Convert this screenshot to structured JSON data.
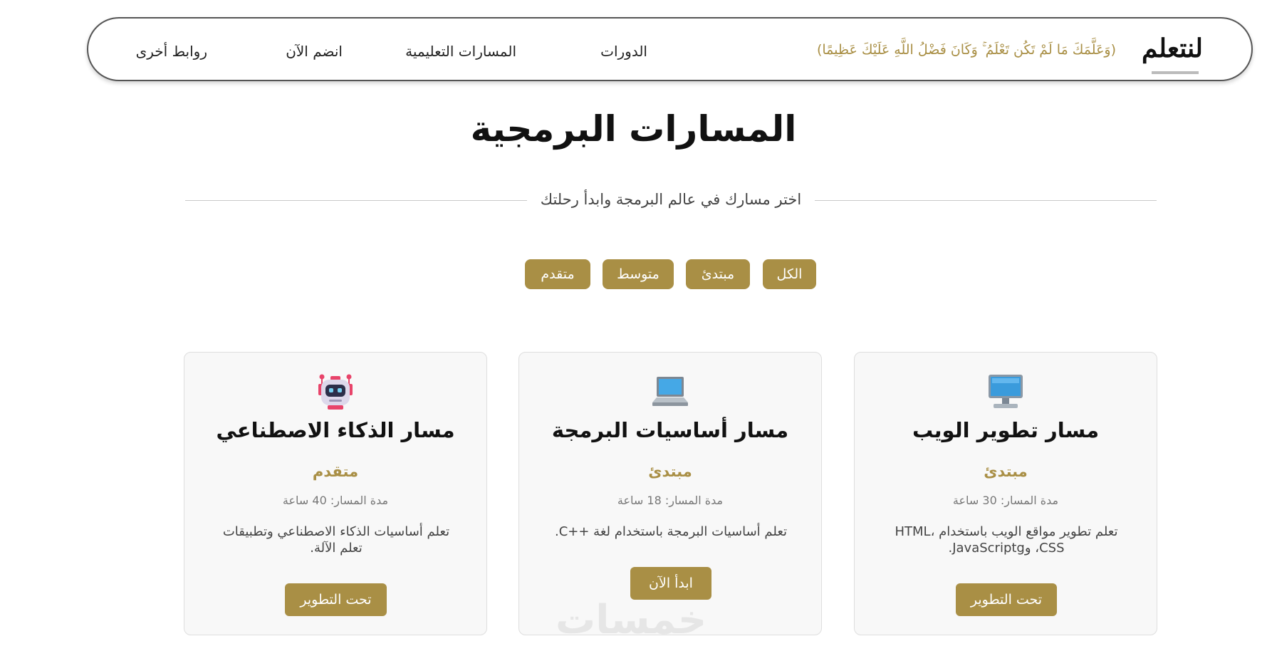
{
  "header": {
    "logo_text": "لنتعلم",
    "verse": "(وَعَلَّمَكَ مَا لَمْ تَكُن تَعْلَمُ ۚ وَكَانَ فَضْلُ اللَّهِ عَلَيْكَ عَظِيمًا)",
    "nav": [
      "الدورات",
      "المسارات التعليمية",
      "انضم الآن",
      "روابط أخرى"
    ]
  },
  "main": {
    "title": "المسارات البرمجية",
    "subtitle": "اختر مسارك في عالم البرمجة وابدأ رحلتك"
  },
  "filters": [
    "الكل",
    "مبتدئ",
    "متوسط",
    "متقدم"
  ],
  "cards": [
    {
      "icon": "desktop-computer-icon",
      "title": "مسار تطوير الويب",
      "level": "مبتدئ",
      "duration": "مدة المسار: 30 ساعة",
      "description": "تعلم تطوير مواقع الويب باستخدام HTML، CSS، وJavaScriptg.",
      "button": "تحت التطوير"
    },
    {
      "icon": "laptop-icon",
      "title": "مسار أساسيات البرمجة",
      "level": "مبتدئ",
      "duration": "مدة المسار: 18 ساعة",
      "description": "تعلم أساسيات البرمجة باستخدام لغة ++C.",
      "button": "ابدأ الآن"
    },
    {
      "icon": "robot-icon",
      "title": "مسار الذكاء الاصطناعي",
      "level": "متقدم",
      "duration": "مدة المسار: 40 ساعة",
      "description": "تعلم أساسيات الذكاء الاصطناعي وتطبيقات تعلم الآلة.",
      "button": "تحت التطوير"
    }
  ],
  "watermark": "خمسات",
  "colors": {
    "accent": "#a98f45",
    "card_bg": "#f8f8f8"
  }
}
